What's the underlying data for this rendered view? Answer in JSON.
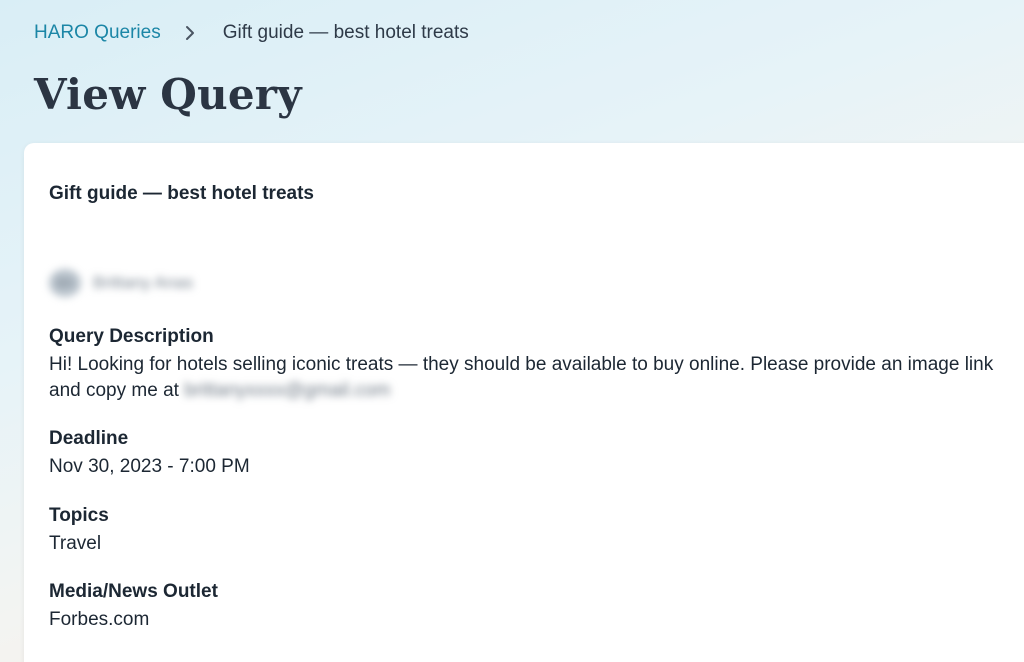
{
  "breadcrumb": {
    "parent": "HARO Queries",
    "current": "Gift guide — best hotel treats"
  },
  "page": {
    "title": "View Query"
  },
  "query": {
    "title": "Gift guide — best hotel treats",
    "author": {
      "initials": "BA",
      "name": "Brittany Anas"
    },
    "description": {
      "label": "Query Description",
      "text": "Hi! Looking for hotels selling iconic treats — they should be available to buy online. Please provide an image link and copy me at ",
      "email": "brittanyxxxx@gmail.com"
    },
    "deadline": {
      "label": "Deadline",
      "value": "Nov 30, 2023 - 7:00 PM"
    },
    "topics": {
      "label": "Topics",
      "value": "Travel"
    },
    "outlet": {
      "label": "Media/News Outlet",
      "value": "Forbes.com"
    }
  }
}
